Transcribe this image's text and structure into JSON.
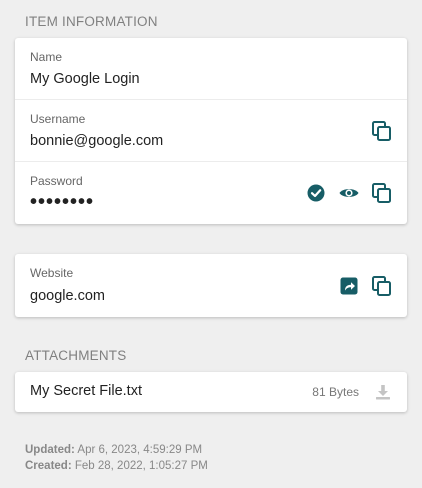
{
  "item_info": {
    "header": "ITEM INFORMATION",
    "name": {
      "label": "Name",
      "value": "My Google Login"
    },
    "username": {
      "label": "Username",
      "value": "bonnie@google.com"
    },
    "password": {
      "label": "Password",
      "value": "••••••••"
    }
  },
  "website": {
    "label": "Website",
    "value": "google.com"
  },
  "attachments": {
    "header": "ATTACHMENTS",
    "items": [
      {
        "name": "My Secret File.txt",
        "size": "81 Bytes"
      }
    ]
  },
  "meta": {
    "updated_label": "Updated:",
    "updated_value": "Apr 6, 2023, 4:59:29 PM",
    "created_label": "Created:",
    "created_value": "Feb 28, 2022, 1:05:27 PM"
  },
  "icons": {
    "copy": "copy-icon",
    "check": "check-circle-icon",
    "eye": "eye-icon",
    "launch": "launch-icon",
    "download": "download-icon"
  },
  "colors": {
    "accent": "#175d66",
    "background": "#efefef",
    "muted_icon": "#c4c4c4"
  }
}
